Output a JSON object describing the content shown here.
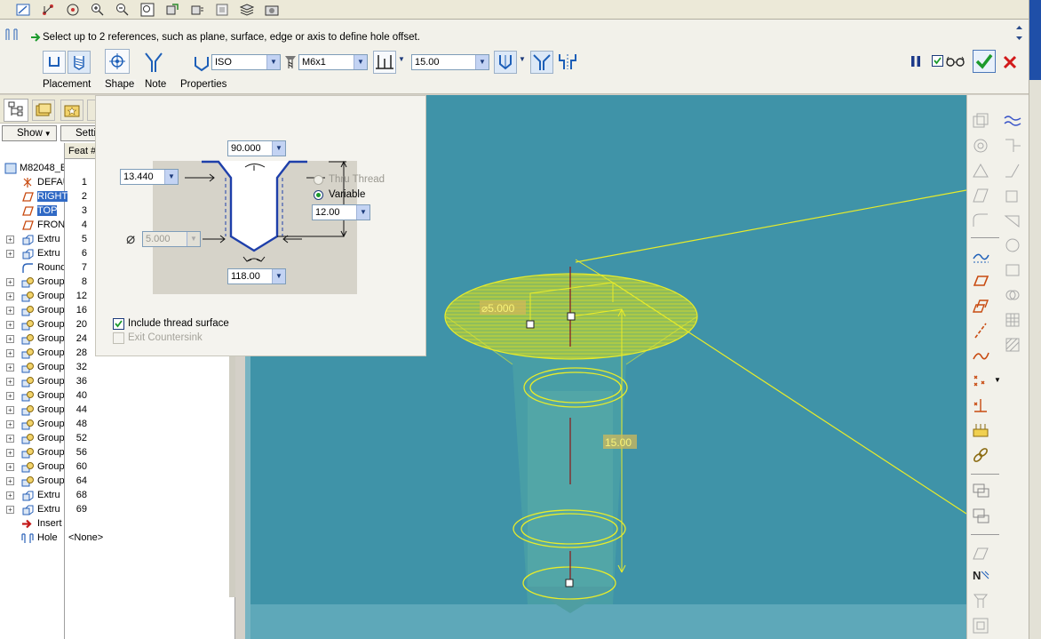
{
  "message": "Select up to 2 references, such as plane, surface, edge or axis to define hole offset.",
  "dashboard": {
    "standard": "ISO",
    "screw_size": "M6x1",
    "depth_value": "15.00",
    "tabs": [
      "Placement",
      "Shape",
      "Note",
      "Properties"
    ]
  },
  "left_panel": {
    "show_button": "Show",
    "settings_button": "Setti",
    "column_feat": "Feat #",
    "root_name": "M82048_E",
    "rows": [
      {
        "name": "DEFAU",
        "num": "1",
        "icon": "csys-icon"
      },
      {
        "name": "RIGHT",
        "num": "2",
        "icon": "datum-plane-icon",
        "selected": true
      },
      {
        "name": "TOP",
        "num": "3",
        "icon": "datum-plane-icon",
        "selected": true
      },
      {
        "name": "FRON",
        "num": "4",
        "icon": "datum-plane-icon"
      },
      {
        "name": "Extru",
        "num": "5",
        "icon": "extrude-icon"
      },
      {
        "name": "Extru",
        "num": "6",
        "icon": "extrude-icon"
      },
      {
        "name": "Round",
        "num": "7",
        "icon": "round-icon"
      },
      {
        "name": "Group",
        "num": "8",
        "icon": "group-icon"
      },
      {
        "name": "Group",
        "num": "12",
        "icon": "group-icon"
      },
      {
        "name": "Group",
        "num": "16",
        "icon": "group-icon"
      },
      {
        "name": "Group",
        "num": "20",
        "icon": "group-icon"
      },
      {
        "name": "Group",
        "num": "24",
        "icon": "group-icon"
      },
      {
        "name": "Group",
        "num": "28",
        "icon": "group-icon"
      },
      {
        "name": "Group",
        "num": "32",
        "icon": "group-icon"
      },
      {
        "name": "Group",
        "num": "36",
        "icon": "group-icon"
      },
      {
        "name": "Group",
        "num": "40",
        "icon": "group-icon"
      },
      {
        "name": "Group",
        "num": "44",
        "icon": "group-icon"
      },
      {
        "name": "Group",
        "num": "48",
        "icon": "group-icon"
      },
      {
        "name": "Group",
        "num": "52",
        "icon": "group-icon"
      },
      {
        "name": "Group",
        "num": "56",
        "icon": "group-icon"
      },
      {
        "name": "Group",
        "num": "60",
        "icon": "group-icon"
      },
      {
        "name": "Group",
        "num": "64",
        "icon": "group-icon"
      },
      {
        "name": "Extru",
        "num": "68",
        "icon": "extrude-icon"
      },
      {
        "name": "Extru",
        "num": "69",
        "icon": "extrude-icon"
      },
      {
        "name": "Insert",
        "num": "",
        "icon": "insert-arrow-icon"
      },
      {
        "name": "Hole",
        "num": "<None>",
        "icon": "hole-icon"
      }
    ]
  },
  "shape": {
    "countersink_angle": "90.000",
    "countersink_diameter": "13.440",
    "hole_diameter": "5.000",
    "drill_angle": "118.00",
    "thru_thread_label": "Thru Thread",
    "variable_label": "Variable",
    "thread_depth": "12.00",
    "include_thread_label": "Include thread surface",
    "exit_countersink_label": "Exit Countersink"
  },
  "viewport": {
    "diameter_label": "⌀5.000",
    "depth_label": "15.00"
  },
  "colors": {
    "viewport_bg": "#3f93a8",
    "preview_yellow": "#e8ec2a",
    "selection": "#316ac5",
    "accept_green": "#1c9a2c",
    "cancel_red": "#d21a1a"
  }
}
